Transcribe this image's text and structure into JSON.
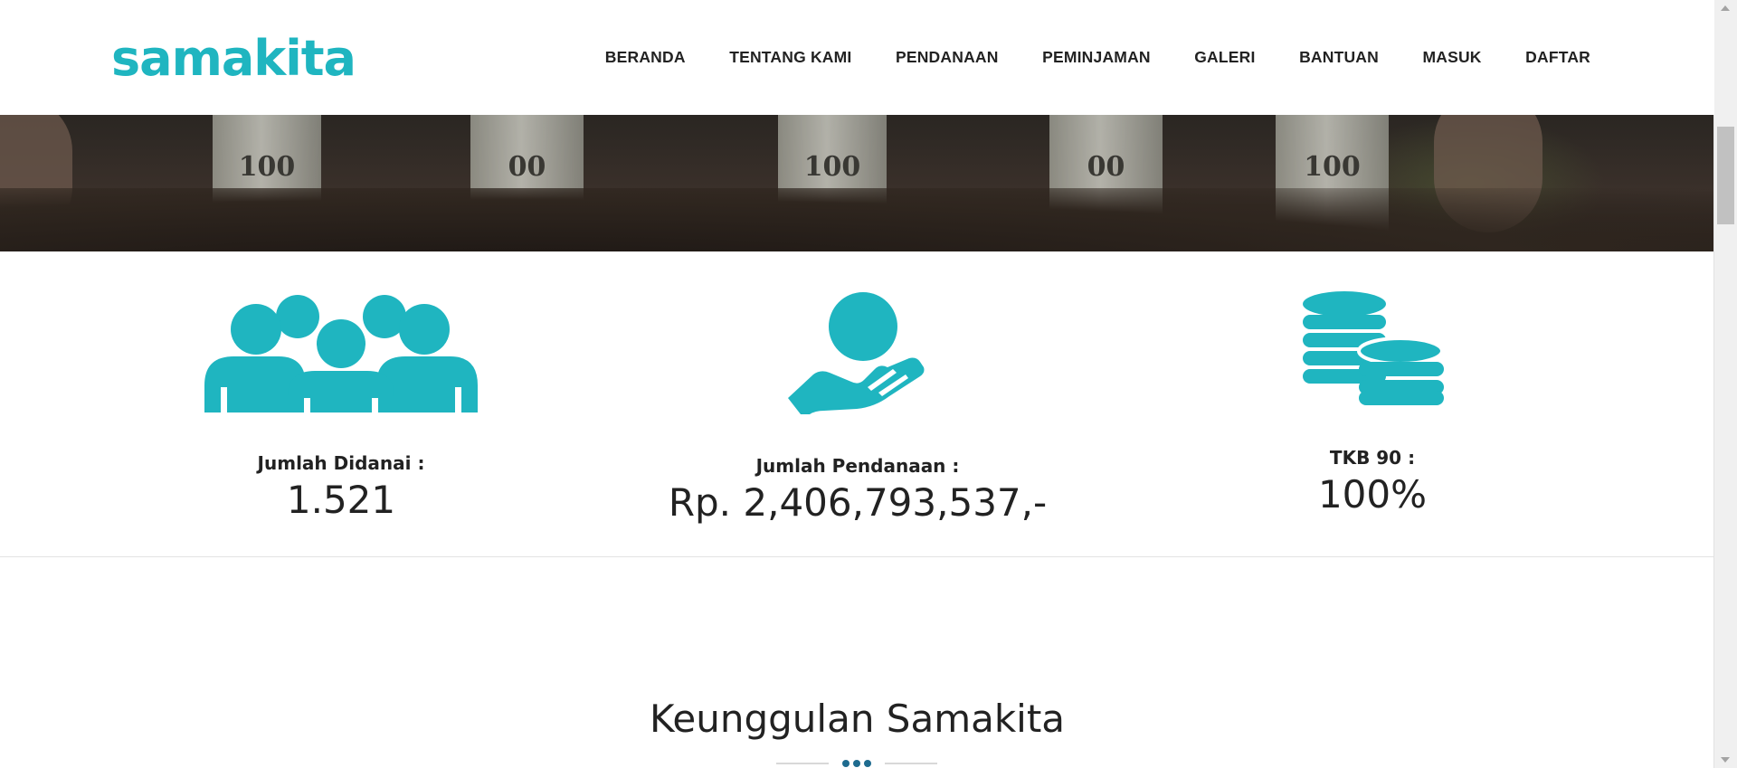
{
  "brand": {
    "logo_text": "samakita",
    "accent_color": "#1fb5c0"
  },
  "nav": {
    "items": [
      {
        "label": "BERANDA"
      },
      {
        "label": "TENTANG KAMI"
      },
      {
        "label": "PENDANAAN"
      },
      {
        "label": "PEMINJAMAN"
      },
      {
        "label": "GALERI"
      },
      {
        "label": "BANTUAN"
      },
      {
        "label": "MASUK"
      },
      {
        "label": "DAFTAR"
      }
    ]
  },
  "hero": {
    "bill_digits": [
      "100",
      "00",
      "100",
      "00",
      "100"
    ]
  },
  "stats": [
    {
      "icon": "people-group-icon",
      "label": "Jumlah Didanai :",
      "value": "1.521"
    },
    {
      "icon": "hand-coin-icon",
      "label": "Jumlah Pendanaan :",
      "value": "Rp. 2,406,793,537,-"
    },
    {
      "icon": "coins-stack-icon",
      "label": "TKB 90 :",
      "value": "100%"
    }
  ],
  "section": {
    "title": "Keunggulan Samakita"
  },
  "colors": {
    "icon": "#1fb5c0",
    "divider_dot": "#1e6b8f"
  }
}
